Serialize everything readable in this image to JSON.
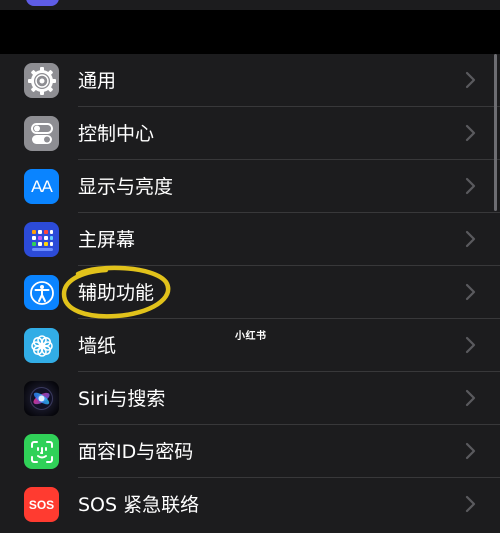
{
  "settings": {
    "items": [
      {
        "label": "通用",
        "icon": "gear-icon",
        "icon_bg": "#8e8e93"
      },
      {
        "label": "控制中心",
        "icon": "control-center-toggles-icon",
        "icon_bg": "#8e8e93"
      },
      {
        "label": "显示与亮度",
        "icon": "text-size-aa-icon",
        "icon_bg": "#0a84ff",
        "icon_text": "AA"
      },
      {
        "label": "主屏幕",
        "icon": "home-screen-grid-icon",
        "icon_bg": "#2c4bd8"
      },
      {
        "label": "辅助功能",
        "icon": "accessibility-person-icon",
        "icon_bg": "#0a84ff"
      },
      {
        "label": "墙纸",
        "icon": "wallpaper-flower-icon",
        "icon_bg": "#32ade6"
      },
      {
        "label": "Siri与搜索",
        "icon": "siri-orb-icon",
        "icon_bg": "#1c1c1e"
      },
      {
        "label": "面容ID与密码",
        "icon": "face-id-icon",
        "icon_bg": "#30d158"
      },
      {
        "label": "SOS 紧急联络",
        "icon": "sos-icon",
        "icon_bg": "#ff3b30",
        "icon_text": "SOS"
      }
    ]
  },
  "watermark": "小红书",
  "colors": {
    "background": "#000000",
    "row_bg": "#1c1c1e",
    "separator": "#38383a",
    "chevron": "#5a5a5e",
    "highlight_ring": "#e1c21b"
  }
}
